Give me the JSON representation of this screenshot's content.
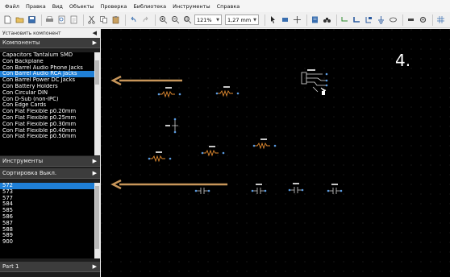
{
  "menubar": {
    "items": [
      "Файл",
      "Правка",
      "Вид",
      "Объекты",
      "Проверка",
      "Библиотека",
      "Инструменты",
      "Справка"
    ]
  },
  "toolbar": {
    "icons": [
      "new-file-icon",
      "open-folder-icon",
      "save-icon",
      "print-icon",
      "print-preview-icon",
      "page-setup-icon",
      "cut-icon",
      "copy-icon",
      "paste-icon",
      "undo-icon",
      "redo-icon",
      "zoom-in-icon",
      "zoom-out-icon",
      "zoom-fit-icon"
    ],
    "zoom_value": "121%",
    "grid_value": "1,27 mm",
    "right_icons": [
      "pointer-icon",
      "component-icon",
      "cross-icon",
      "library-icon",
      "binoculars-icon",
      "wire-icon",
      "bus-icon",
      "net-label-icon",
      "power-icon",
      "circle-icon",
      "pin-icon",
      "settings-icon",
      "grid-icon",
      "more-icon"
    ]
  },
  "left_panel": {
    "caption": "Установить компонент",
    "components_header": "Компоненты",
    "components": [
      "Capacitors Tantalum SMD",
      "Con Backplane",
      "Con Barrel Audio Phone Jacks",
      "Con Barrel Audio RCA Jacks",
      "Con Barrel Power DC Jacks",
      "Con Battery Holders",
      "Con Circular DIN",
      "Con D-Sub (non-IPC)",
      "Con Edge Cards",
      "Con Flat Flexible p0.20mm",
      "Con Flat Flexible p0.25mm",
      "Con Flat Flexible p0.30mm",
      "Con Flat Flexible p0.40mm",
      "Con Flat Flexible p0.50mm"
    ],
    "components_selected_index": 3,
    "tools_header": "Инструменты",
    "sort_header": "Сортировка Выкл.",
    "parts": [
      "572",
      "573",
      "577",
      "584",
      "585",
      "586",
      "587",
      "588",
      "589",
      "900"
    ],
    "parts_selected_index": 0,
    "part_header": "Part 1"
  },
  "canvas": {
    "step_label": "4.",
    "arrow_color": "#c8965a"
  }
}
